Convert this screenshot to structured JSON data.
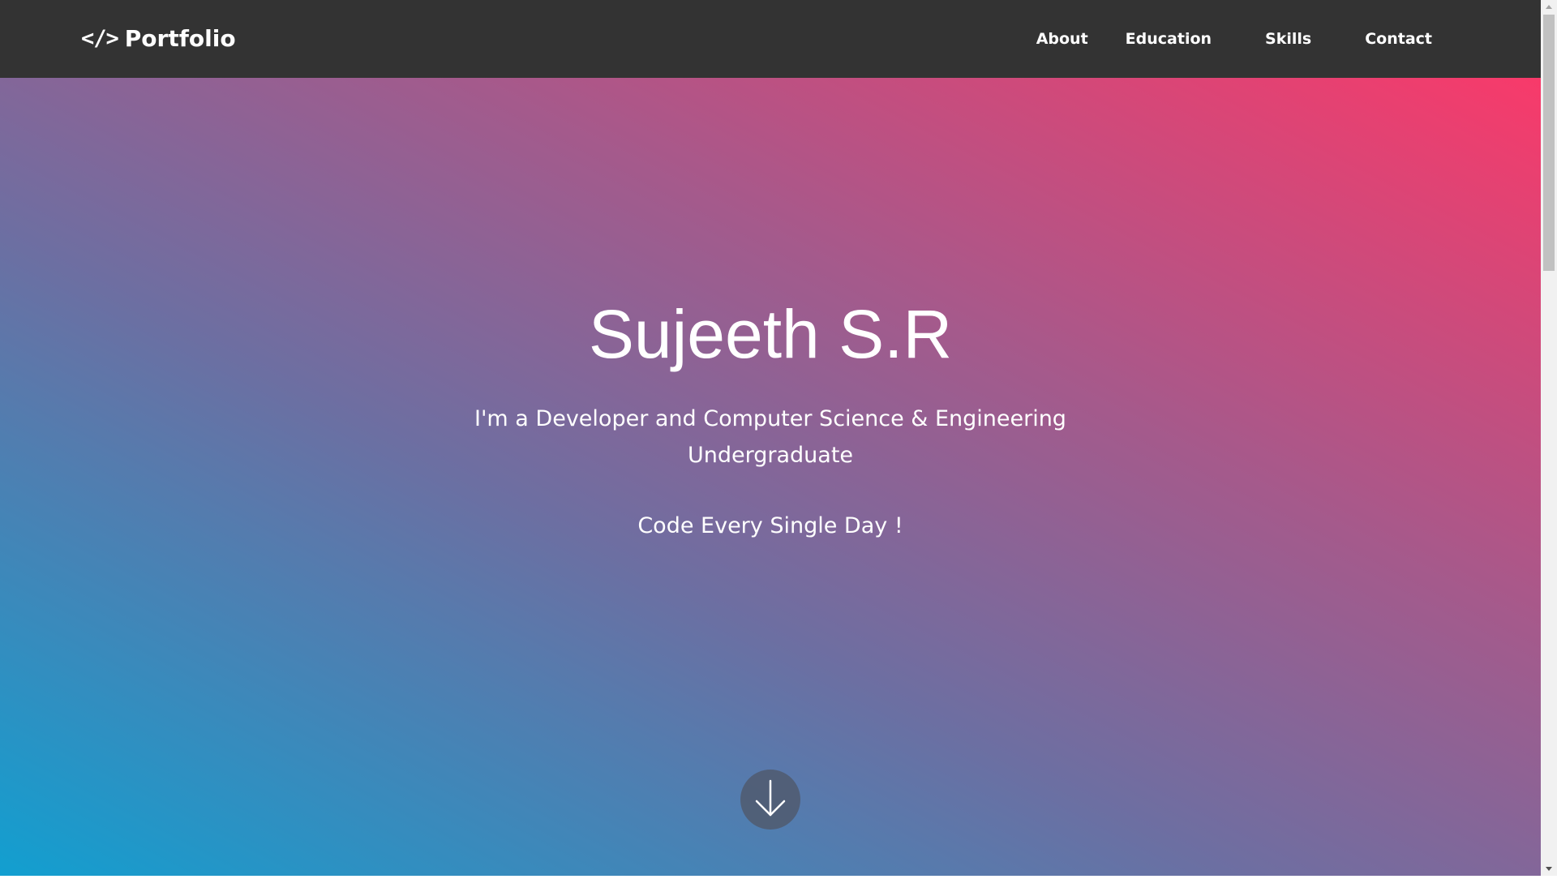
{
  "navbar": {
    "brand_icon": "</>",
    "brand_label": "Portfolio",
    "links": [
      {
        "label": "About"
      },
      {
        "label": "Education"
      },
      {
        "label": "Skills"
      },
      {
        "label": "Contact"
      }
    ],
    "background": "#333333"
  },
  "hero": {
    "name": "Sujeeth S.R",
    "subtitle": "I'm a Developer and Computer Science & Engineering Undergraduate",
    "tagline": "Code Every Single Day !",
    "scroll_button_icon": "arrow-down-icon",
    "gradient_colors": [
      "#129fd0",
      "#6c6fa2",
      "#a45a8c",
      "#f83a6a"
    ]
  }
}
